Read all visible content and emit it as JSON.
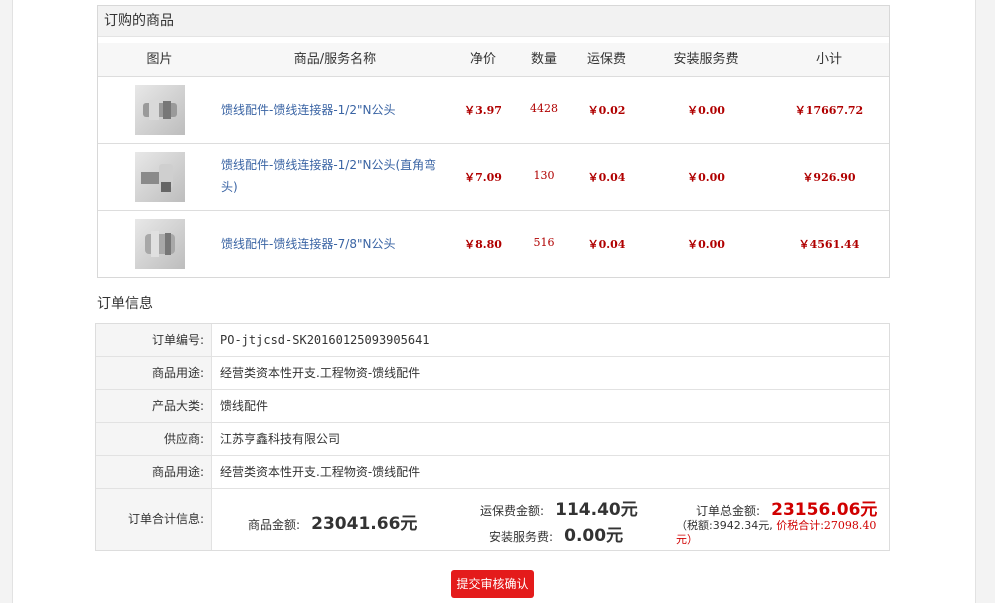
{
  "products_section": {
    "title": "订购的商品",
    "columns": [
      "图片",
      "商品/服务名称",
      "净价",
      "数量",
      "运保费",
      "安装服务费",
      "小计"
    ],
    "rows": [
      {
        "name": "馈线配件-馈线连接器-1/2\"N公头",
        "price": "￥3.97",
        "qty": "4428",
        "shipping": "￥0.02",
        "install": "￥0.00",
        "subtotal": "￥17667.72"
      },
      {
        "name": "馈线配件-馈线连接器-1/2\"N公头(直角弯头)",
        "price": "￥7.09",
        "qty": "130",
        "shipping": "￥0.04",
        "install": "￥0.00",
        "subtotal": "￥926.90"
      },
      {
        "name": "馈线配件-馈线连接器-7/8\"N公头",
        "price": "￥8.80",
        "qty": "516",
        "shipping": "￥0.04",
        "install": "￥0.00",
        "subtotal": "￥4561.44"
      }
    ]
  },
  "order_info": {
    "title": "订单信息",
    "rows": [
      {
        "label": "订单编号:",
        "value": "PO-jtjcsd-SK20160125093905641"
      },
      {
        "label": "商品用途:",
        "value": "经营类资本性开支.工程物资-馈线配件"
      },
      {
        "label": "产品大类:",
        "value": "馈线配件"
      },
      {
        "label": "供应商:",
        "value": "江苏亨鑫科技有限公司"
      },
      {
        "label": "商品用途:",
        "value": "经营类资本性开支.工程物资-馈线配件"
      }
    ],
    "total": {
      "label": "订单合计信息:",
      "goods_label": "商品金额:",
      "goods_value": "23041.66元",
      "shipping_label": "运保费金额:",
      "shipping_value": "114.40元",
      "install_label": "安装服务费:",
      "install_value": "0.00元",
      "order_total_label": "订单总金额:",
      "order_total_value": "23156.06元",
      "tax_line_prefix": "（税额:3942.34元,",
      "tax_line_total_label": "价税合计:",
      "tax_line_total_value": "27098.40",
      "tax_line_suffix": "元）"
    }
  },
  "submit_button": "提交审核确认"
}
